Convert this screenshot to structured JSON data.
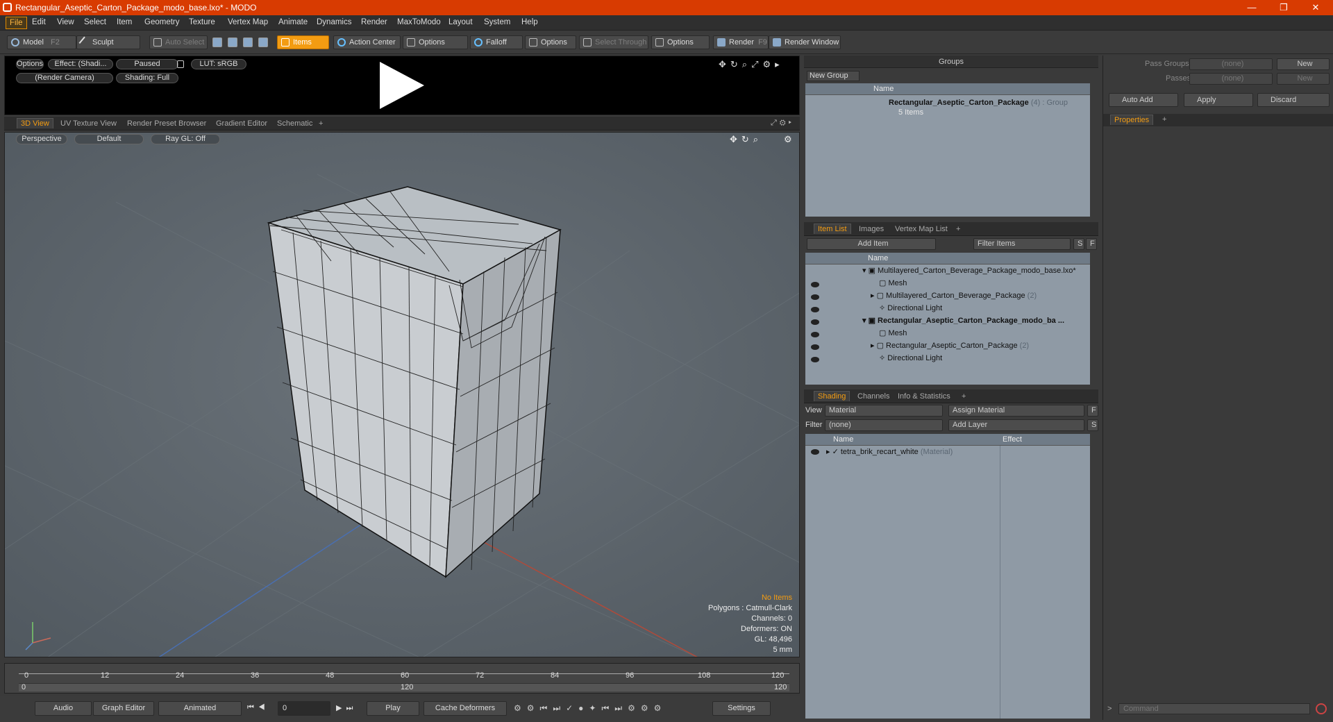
{
  "window": {
    "title": "Rectangular_Aseptic_Carton_Package_modo_base.lxo* - MODO",
    "minimize": "—",
    "maximize": "❐",
    "close": "✕"
  },
  "menu": [
    "File",
    "Edit",
    "View",
    "Select",
    "Item",
    "Geometry",
    "Texture",
    "Vertex Map",
    "Animate",
    "Dynamics",
    "Render",
    "MaxToModo",
    "Layout",
    "System",
    "Help"
  ],
  "toolbar": {
    "model": "Model",
    "model_key": "F2",
    "sculpt": "Sculpt",
    "auto_select": "Auto Select",
    "items": "Items",
    "action_center": "Action Center",
    "options1": "Options",
    "falloff": "Falloff",
    "options2": "Options",
    "select_through": "Select Through",
    "options3": "Options",
    "render": "Render",
    "render_key": "F9",
    "render_window": "Render Window"
  },
  "preview": {
    "options": "Options",
    "effect": "Effect: (Shadi...",
    "paused": "Paused",
    "lut": "LUT: sRGB",
    "camera": "(Render Camera)",
    "shading": "Shading: Full"
  },
  "viewport_tabs": [
    "3D View",
    "UV Texture View",
    "Render Preset Browser",
    "Gradient Editor",
    "Schematic",
    "+"
  ],
  "viewport": {
    "perspective": "Perspective",
    "default": "Default",
    "raygl": "Ray GL: Off",
    "info": {
      "no_items": "No Items",
      "polygons": "Polygons : Catmull-Clark",
      "channels": "Channels: 0",
      "deformers": "Deformers: ON",
      "gl": "GL: 48,496",
      "unit": "5 mm"
    }
  },
  "timeline": {
    "ticks": [
      "0",
      "12",
      "24",
      "36",
      "48",
      "60",
      "72",
      "84",
      "96",
      "108",
      "120"
    ],
    "sub_start": "0",
    "sub_mid": "120",
    "sub_end": "120"
  },
  "bottombar": {
    "audio": "Audio",
    "graph_editor": "Graph Editor",
    "animated": "Animated",
    "frame": "0",
    "play": "Play",
    "cache": "Cache Deformers",
    "settings": "Settings"
  },
  "groups": {
    "title": "Groups",
    "new_group": "New Group",
    "col_name": "Name",
    "item_name": "Rectangular_Aseptic_Carton_Package",
    "item_count": "(4)",
    "item_type": ": Group",
    "item_sub": "5 Items"
  },
  "itemlist": {
    "tabs": [
      "Item List",
      "Images",
      "Vertex Map List",
      "+"
    ],
    "add_item": "Add Item",
    "filter": "Filter Items",
    "s": "S",
    "f": "F",
    "col_name": "Name",
    "rows": [
      {
        "label": "Multilayered_Carton_Beverage_Package_modo_base.lxo*",
        "extra": ""
      },
      {
        "label": "Mesh",
        "extra": ""
      },
      {
        "label": "Multilayered_Carton_Beverage_Package",
        "extra": "(2)"
      },
      {
        "label": "Directional Light",
        "extra": ""
      },
      {
        "label": "Rectangular_Aseptic_Carton_Package_modo_ba ...",
        "extra": ""
      },
      {
        "label": "Mesh",
        "extra": ""
      },
      {
        "label": "Rectangular_Aseptic_Carton_Package",
        "extra": "(2)"
      },
      {
        "label": "Directional Light",
        "extra": ""
      }
    ]
  },
  "shading": {
    "tabs": [
      "Shading",
      "Channels",
      "Info & Statistics",
      "+"
    ],
    "view_label": "View",
    "view_value": "Material",
    "assign": "Assign Material",
    "f": "F",
    "filter_label": "Filter",
    "filter_value": "(none)",
    "add_layer": "Add Layer",
    "s": "S",
    "col_name": "Name",
    "col_effect": "Effect",
    "row_name": "tetra_brik_recart_white",
    "row_type": "(Material)"
  },
  "passes": {
    "pass_groups": "Pass Groups",
    "pass_value": "(none)",
    "new1": "New",
    "passes": "Passes",
    "passes_value": "(none)",
    "new2": "New",
    "auto_add": "Auto Add",
    "apply": "Apply",
    "discard": "Discard"
  },
  "properties": {
    "tab": "Properties",
    "plus": "+"
  },
  "command": {
    "placeholder": "Command",
    "prompt": ">"
  },
  "colors": {
    "accent": "#f39c12",
    "titlebar": "#d83b01",
    "list_bg": "#8f9aa5"
  }
}
